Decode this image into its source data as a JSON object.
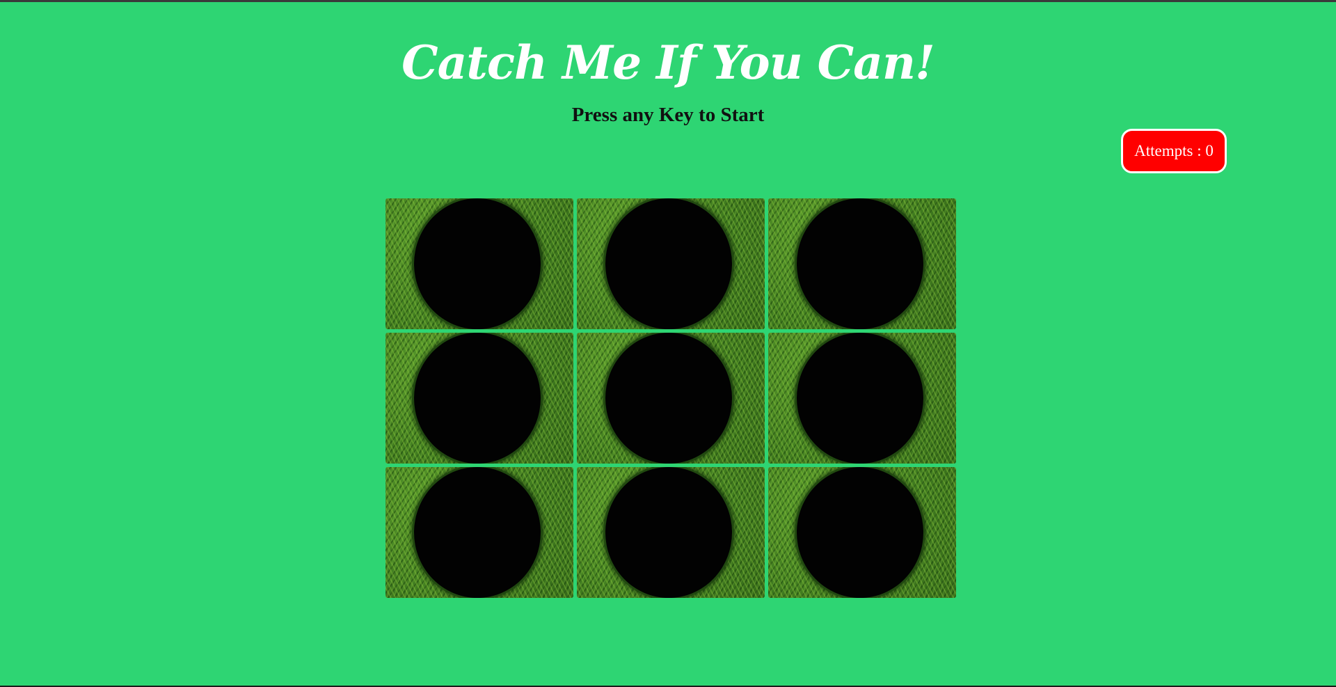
{
  "game": {
    "title": "Catch Me If You Can!",
    "instruction": "Press any Key to Start",
    "attempts_label": "Attempts : 0",
    "attempts": 0
  },
  "board": {
    "rows": 3,
    "columns": 3,
    "holes": [
      {
        "name": "hole-1",
        "state": "empty"
      },
      {
        "name": "hole-2",
        "state": "empty"
      },
      {
        "name": "hole-3",
        "state": "empty"
      },
      {
        "name": "hole-4",
        "state": "empty"
      },
      {
        "name": "hole-5",
        "state": "empty"
      },
      {
        "name": "hole-6",
        "state": "empty"
      },
      {
        "name": "hole-7",
        "state": "empty"
      },
      {
        "name": "hole-8",
        "state": "empty"
      },
      {
        "name": "hole-9",
        "state": "empty"
      }
    ]
  },
  "colors": {
    "background": "#2ed573",
    "attempts_badge": "#ff0000",
    "title_text": "#ffffff"
  }
}
